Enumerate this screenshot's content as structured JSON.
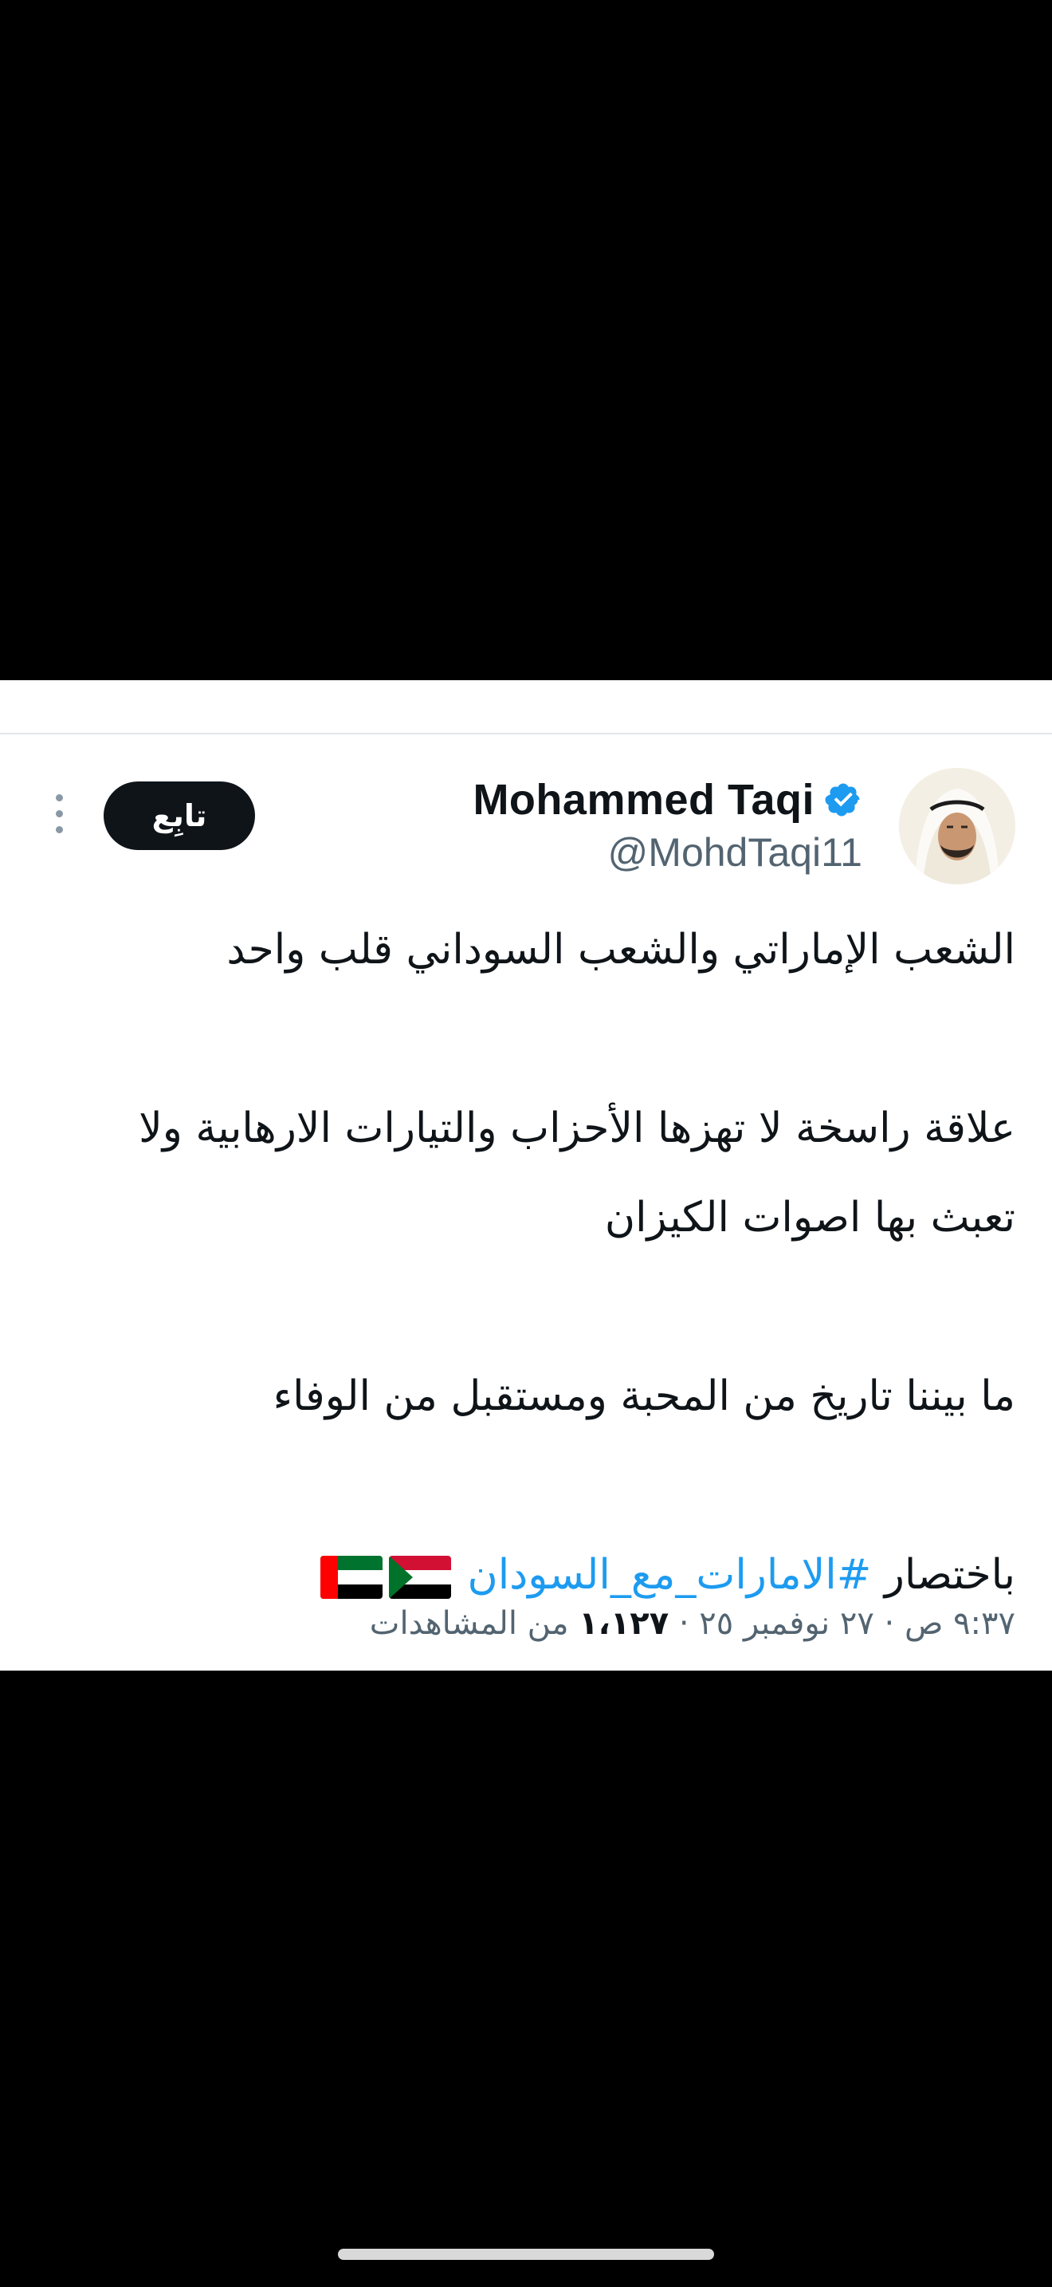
{
  "tweet": {
    "display_name": "Mohammed Taqi",
    "handle": "@MohdTaqi11",
    "follow_label": "تابِع",
    "lines": {
      "l1": "الشعب الإماراتي والشعب السوداني قلب واحد",
      "l2": "علاقة راسخة لا تهزها الأحزاب والتيارات الارهابية ولا",
      "l3": "تعبث بها اصوات الكيزان",
      "l4": "ما بيننا تاريخ من المحبة ومستقبل من الوفاء",
      "l5_prefix": "باختصار ",
      "l5_hashtag": "#الامارات_مع_السودان"
    },
    "flags": [
      "sudan-flag",
      "uae-flag"
    ],
    "meta": {
      "time_date": "٩:٣٧ ص · ٢٧ نوفمبر ٢٥ · ",
      "views_count": "١،١٢٧",
      "views_label": " من المشاهدات"
    }
  },
  "colors": {
    "text": "#0f1419",
    "secondary": "#536471",
    "link": "#1d9bf0",
    "verified": "#1d9bf0",
    "button_bg": "#0f1419"
  },
  "icons": {
    "verified": "verified-badge-icon",
    "more": "more-vertical-icon"
  }
}
